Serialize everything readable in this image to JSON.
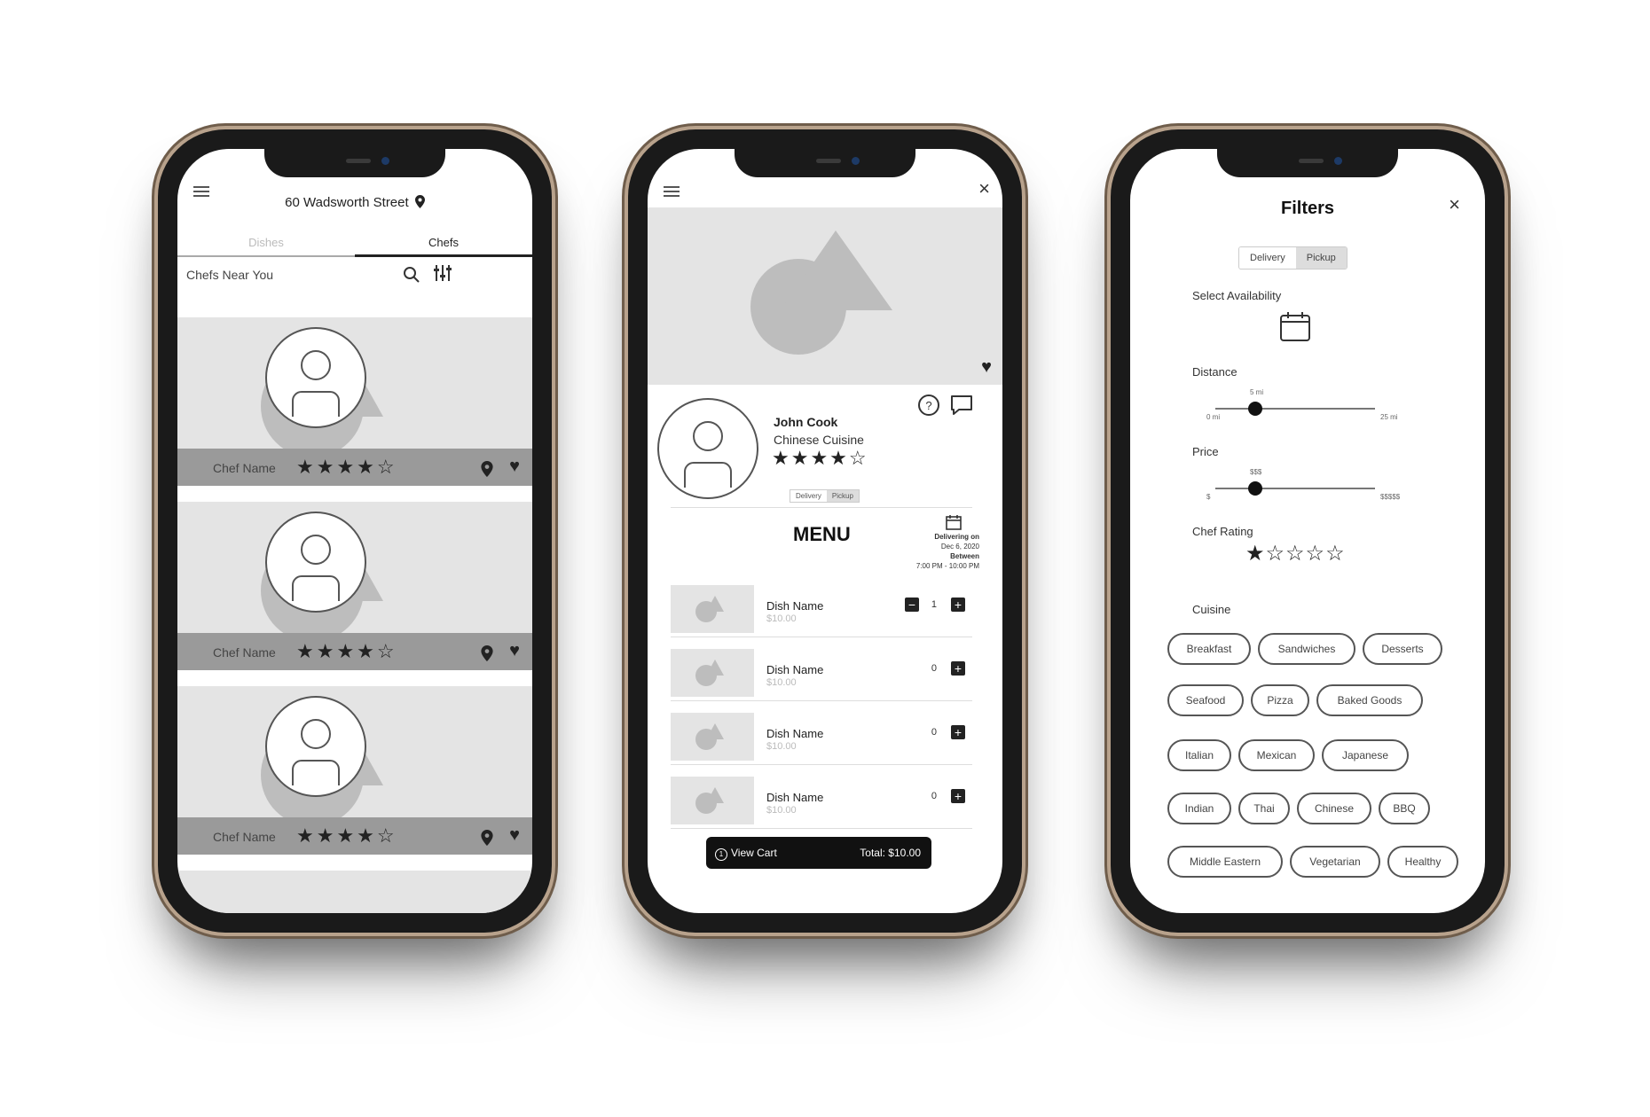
{
  "phone1": {
    "address": "60 Wadsworth Street",
    "tabs": {
      "dishes": "Dishes",
      "chefs": "Chefs"
    },
    "section_title": "Chefs Near You",
    "cards": [
      {
        "name": "Chef Name",
        "stars": "★★★★☆"
      },
      {
        "name": "Chef Name",
        "stars": "★★★★☆"
      },
      {
        "name": "Chef Name",
        "stars": "★★★★☆"
      }
    ]
  },
  "phone2": {
    "chef_name": "John Cook",
    "cuisine": "Chinese Cuisine",
    "stars": "★★★★☆",
    "toggle": {
      "delivery": "Delivery",
      "pickup": "Pickup"
    },
    "menu_title": "MENU",
    "delivery_info": [
      "Delivering on",
      "Dec 6, 2020",
      "Between",
      "7:00 PM - 10:00 PM"
    ],
    "dishes": [
      {
        "name": "Dish Name",
        "price": "$10.00",
        "qty": "1"
      },
      {
        "name": "Dish Name",
        "price": "$10.00",
        "qty": "0"
      },
      {
        "name": "Dish Name",
        "price": "$10.00",
        "qty": "0"
      },
      {
        "name": "Dish Name",
        "price": "$10.00",
        "qty": "0"
      }
    ],
    "cart": {
      "view": "View Cart",
      "total": "Total: $10.00",
      "count": "1"
    }
  },
  "phone3": {
    "title": "Filters",
    "toggle": {
      "delivery": "Delivery",
      "pickup": "Pickup"
    },
    "availability_label": "Select Availability",
    "distance": {
      "label": "Distance",
      "min": "0 mi",
      "value": "5 mi",
      "max": "25 mi",
      "fraction": 0.25
    },
    "price": {
      "label": "Price",
      "min": "$",
      "value": "$$$",
      "max": "$$$$$",
      "fraction": 0.25
    },
    "rating_label": "Chef Rating",
    "rating_stars": "★☆☆☆☆",
    "cuisine_label": "Cuisine",
    "cuisines": [
      "Breakfast",
      "Sandwiches",
      "Desserts",
      "Seafood",
      "Pizza",
      "Baked Goods",
      "Italian",
      "Mexican",
      "Japanese",
      "Indian",
      "Thai",
      "Chinese",
      "BBQ",
      "Middle Eastern",
      "Vegetarian",
      "Healthy"
    ]
  }
}
